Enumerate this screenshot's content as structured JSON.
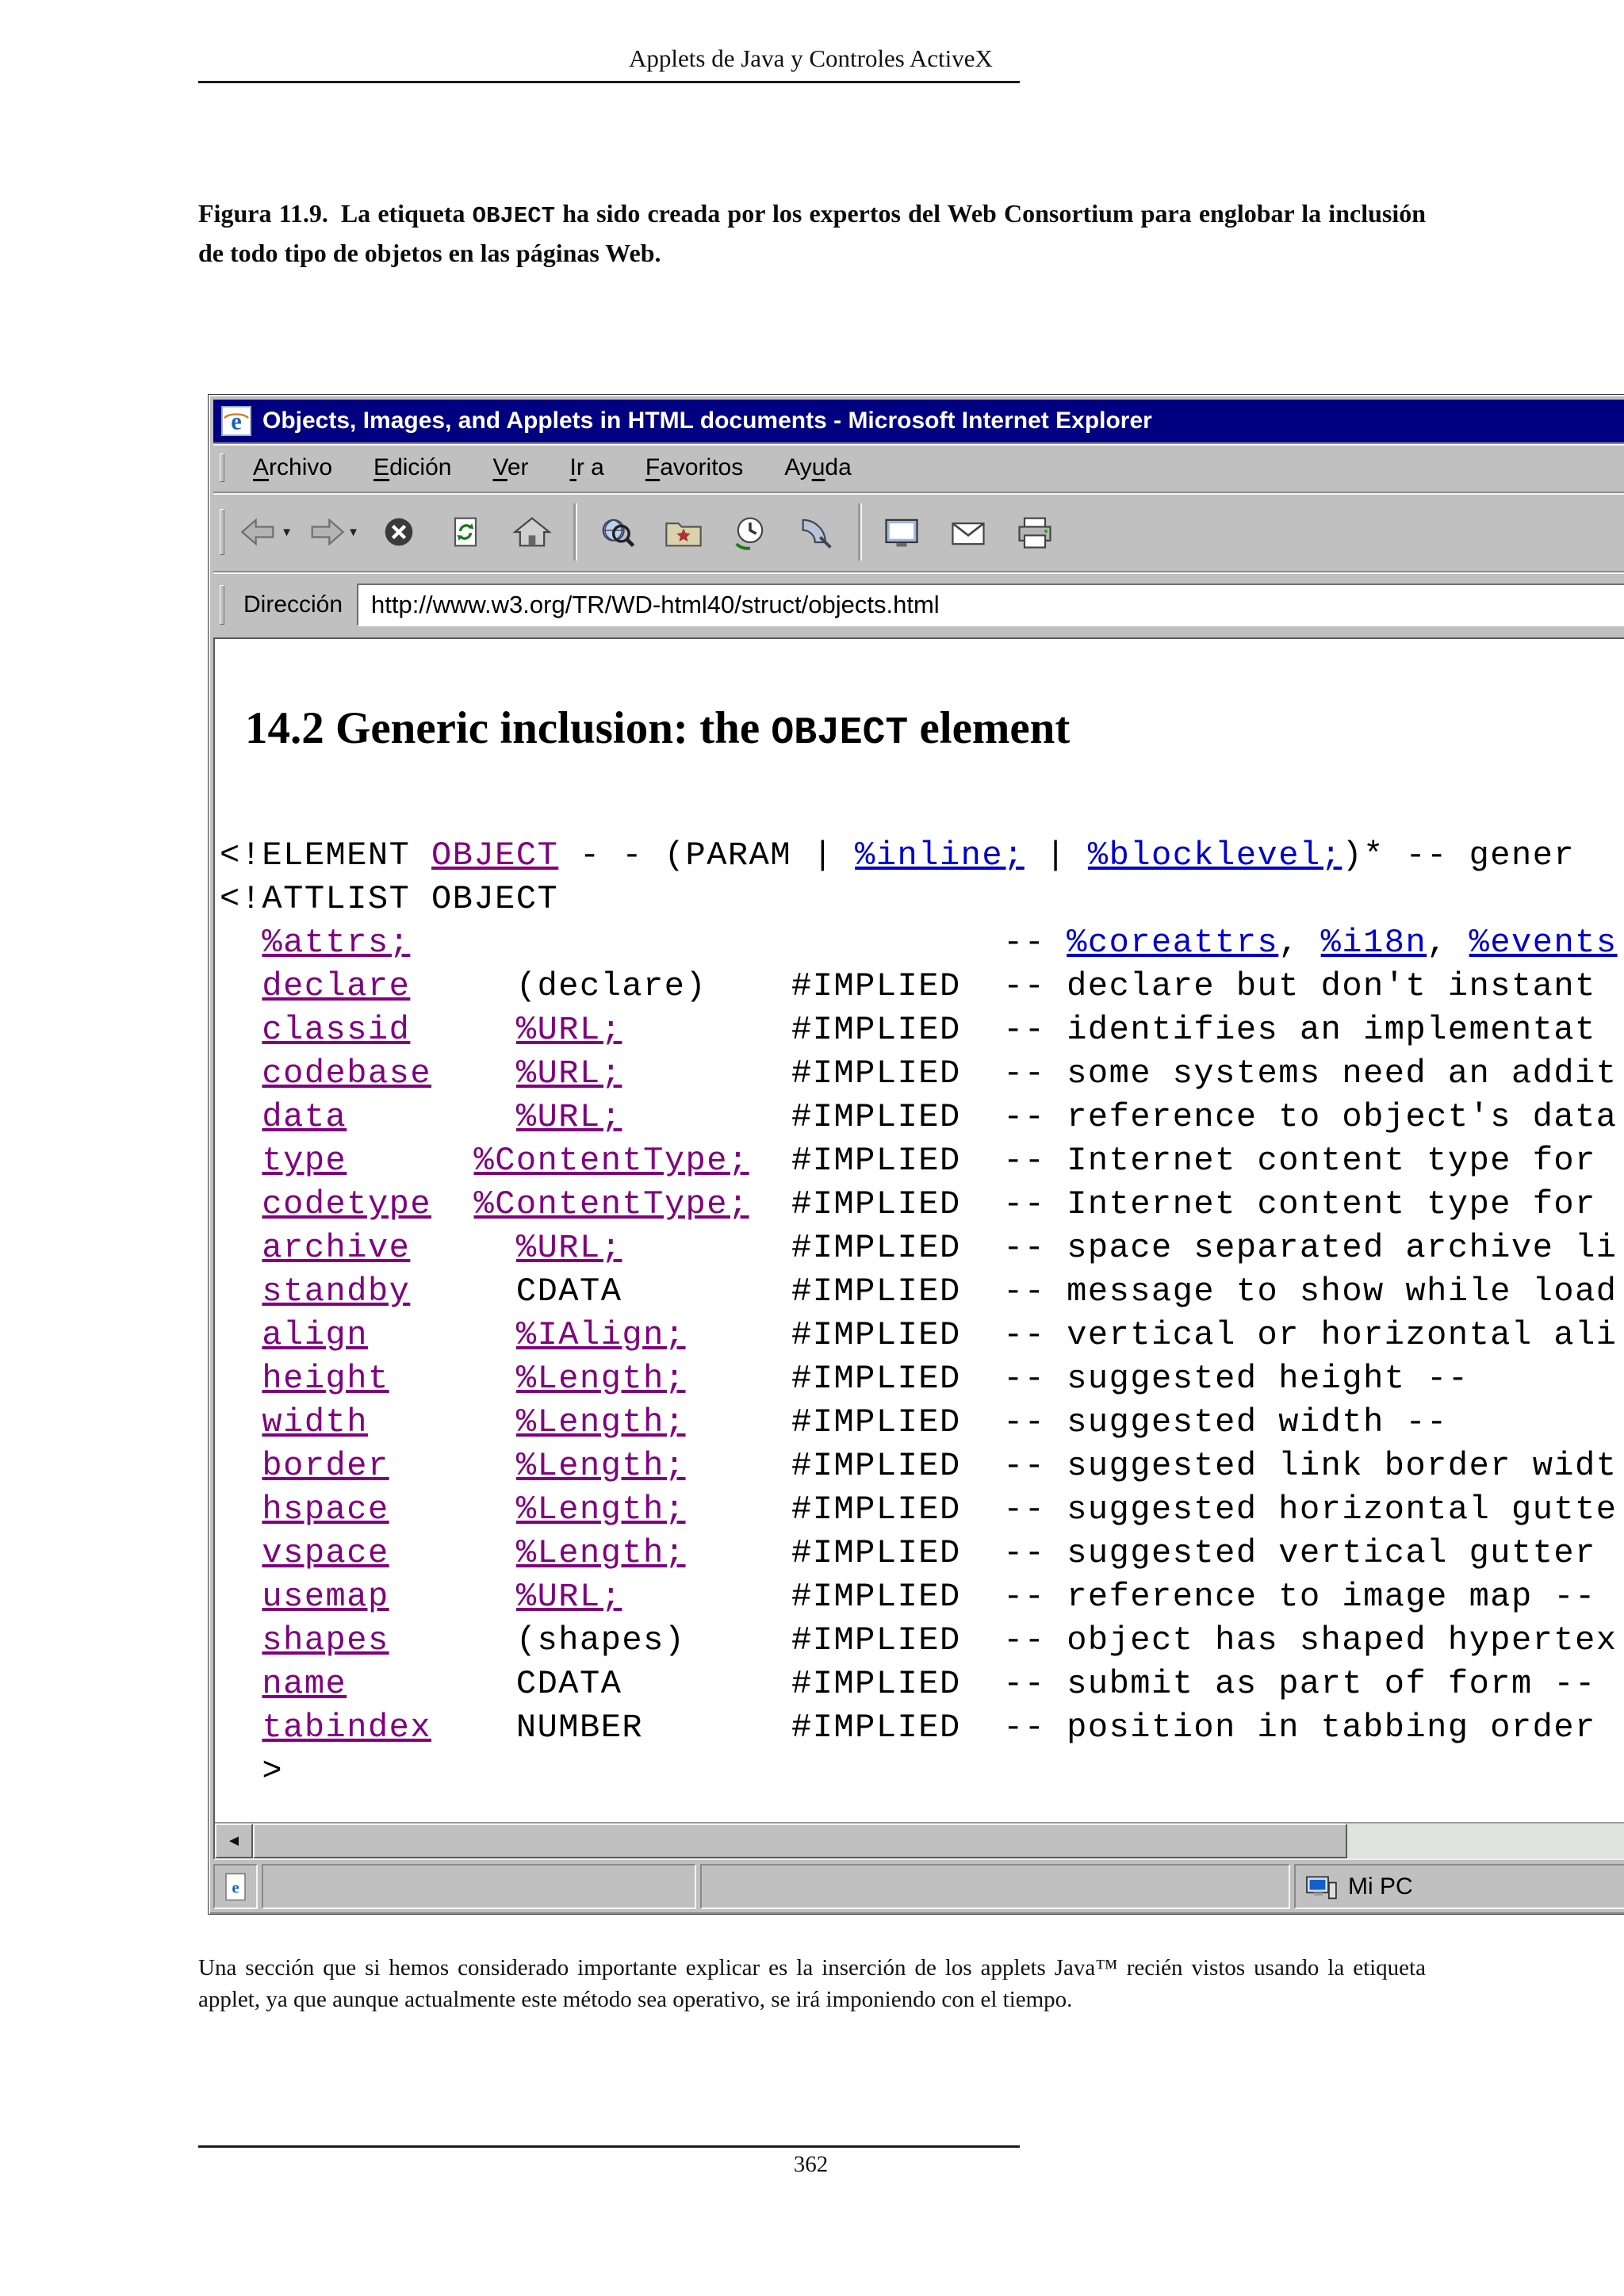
{
  "page": {
    "header_title": "Applets de Java y Controles ActiveX",
    "figure_caption": {
      "label": "Figura 11.9.",
      "text_before_code": "La etiqueta ",
      "code": "OBJECT",
      "text_after_code": " ha sido creada por los expertos del Web Consortium para englobar la inclusión de todo tipo de objetos en las páginas Web."
    },
    "body_paragraph": "Una sección que si hemos considerado importante explicar es la inserción de los applets Java™ recién vistos usando la etiqueta applet, ya que aunque actualmente este método sea operativo, se irá imponiendo con el tiempo.",
    "page_number": "362"
  },
  "ie_window": {
    "title": "Objects, Images, and Applets in HTML documents - Microsoft Internet Explorer",
    "menu": [
      {
        "label": "Archivo",
        "accel": 0
      },
      {
        "label": "Edición",
        "accel": 0
      },
      {
        "label": "Ver",
        "accel": 0
      },
      {
        "label": "Ir a",
        "accel": 0
      },
      {
        "label": "Favoritos",
        "accel": 0
      },
      {
        "label": "Ayuda",
        "accel": 2
      }
    ],
    "toolbar_buttons": [
      "back",
      "forward",
      "stop",
      "refresh",
      "home",
      "search",
      "favorites",
      "history",
      "channels",
      "fullscreen",
      "mail",
      "print"
    ],
    "address": {
      "label": "Dirección",
      "url": "http://www.w3.org/TR/WD-html40/struct/objects.html"
    },
    "status_zone": "Mi PC",
    "colors": {
      "titlebar": "#000080",
      "link": "#0000cc",
      "visited_link": "#800080"
    },
    "content": {
      "heading_pre": "14.2 Generic inclusion: the ",
      "heading_code": "OBJECT",
      "heading_post": " element",
      "dtd_lines": [
        [
          [
            "<!ELEMENT ",
            "p"
          ],
          [
            "OBJECT",
            "v"
          ],
          [
            " - - (PARAM | ",
            "p"
          ],
          [
            "%inline;",
            "l"
          ],
          [
            " | ",
            "p"
          ],
          [
            "%blocklevel;",
            "l"
          ],
          [
            ")* -- gener",
            "p"
          ]
        ],
        [
          [
            "<!ATTLIST OBJECT",
            "p"
          ]
        ],
        [
          [
            "  ",
            "p"
          ],
          [
            "%attrs;",
            "v"
          ],
          [
            "                            ",
            "p"
          ],
          [
            "-- ",
            "p"
          ],
          [
            "%coreattrs",
            "l"
          ],
          [
            ", ",
            "p"
          ],
          [
            "%i18n",
            "l"
          ],
          [
            ", ",
            "p"
          ],
          [
            "%events",
            "l"
          ]
        ],
        [
          [
            "  ",
            "p"
          ],
          [
            "declare",
            "v"
          ],
          [
            "     (declare)    #IMPLIED  -- declare but don't instant",
            "p"
          ]
        ],
        [
          [
            "  ",
            "p"
          ],
          [
            "classid",
            "v"
          ],
          [
            "     ",
            "p"
          ],
          [
            "%URL;",
            "v"
          ],
          [
            "        #IMPLIED  -- identifies an implementat",
            "p"
          ]
        ],
        [
          [
            "  ",
            "p"
          ],
          [
            "codebase",
            "v"
          ],
          [
            "    ",
            "p"
          ],
          [
            "%URL;",
            "v"
          ],
          [
            "        #IMPLIED  -- some systems need an addit",
            "p"
          ]
        ],
        [
          [
            "  ",
            "p"
          ],
          [
            "data",
            "v"
          ],
          [
            "        ",
            "p"
          ],
          [
            "%URL;",
            "v"
          ],
          [
            "        #IMPLIED  -- reference to object's data",
            "p"
          ]
        ],
        [
          [
            "  ",
            "p"
          ],
          [
            "type",
            "v"
          ],
          [
            "      ",
            "p"
          ],
          [
            "%ContentType;",
            "v"
          ],
          [
            "  #IMPLIED  -- Internet content type for",
            "p"
          ]
        ],
        [
          [
            "  ",
            "p"
          ],
          [
            "codetype",
            "v"
          ],
          [
            "  ",
            "p"
          ],
          [
            "%ContentType;",
            "v"
          ],
          [
            "  #IMPLIED  -- Internet content type for",
            "p"
          ]
        ],
        [
          [
            "  ",
            "p"
          ],
          [
            "archive",
            "v"
          ],
          [
            "     ",
            "p"
          ],
          [
            "%URL;",
            "v"
          ],
          [
            "        #IMPLIED  -- space separated archive li",
            "p"
          ]
        ],
        [
          [
            "  ",
            "p"
          ],
          [
            "standby",
            "v"
          ],
          [
            "     CDATA        #IMPLIED  -- message to show while load",
            "p"
          ]
        ],
        [
          [
            "  ",
            "p"
          ],
          [
            "align",
            "v"
          ],
          [
            "       ",
            "p"
          ],
          [
            "%IAlign;",
            "v"
          ],
          [
            "     #IMPLIED  -- vertical or horizontal ali",
            "p"
          ]
        ],
        [
          [
            "  ",
            "p"
          ],
          [
            "height",
            "v"
          ],
          [
            "      ",
            "p"
          ],
          [
            "%Length;",
            "v"
          ],
          [
            "     #IMPLIED  -- suggested height --",
            "p"
          ]
        ],
        [
          [
            "  ",
            "p"
          ],
          [
            "width",
            "v"
          ],
          [
            "       ",
            "p"
          ],
          [
            "%Length;",
            "v"
          ],
          [
            "     #IMPLIED  -- suggested width --",
            "p"
          ]
        ],
        [
          [
            "  ",
            "p"
          ],
          [
            "border",
            "v"
          ],
          [
            "      ",
            "p"
          ],
          [
            "%Length;",
            "v"
          ],
          [
            "     #IMPLIED  -- suggested link border widt",
            "p"
          ]
        ],
        [
          [
            "  ",
            "p"
          ],
          [
            "hspace",
            "v"
          ],
          [
            "      ",
            "p"
          ],
          [
            "%Length;",
            "v"
          ],
          [
            "     #IMPLIED  -- suggested horizontal gutte",
            "p"
          ]
        ],
        [
          [
            "  ",
            "p"
          ],
          [
            "vspace",
            "v"
          ],
          [
            "      ",
            "p"
          ],
          [
            "%Length;",
            "v"
          ],
          [
            "     #IMPLIED  -- suggested vertical gutter",
            "p"
          ]
        ],
        [
          [
            "  ",
            "p"
          ],
          [
            "usemap",
            "v"
          ],
          [
            "      ",
            "p"
          ],
          [
            "%URL;",
            "v"
          ],
          [
            "        #IMPLIED  -- reference to image map --",
            "p"
          ]
        ],
        [
          [
            "  ",
            "p"
          ],
          [
            "shapes",
            "v"
          ],
          [
            "      (shapes)     #IMPLIED  -- object has shaped hypertex",
            "p"
          ]
        ],
        [
          [
            "  ",
            "p"
          ],
          [
            "name",
            "v"
          ],
          [
            "        CDATA        #IMPLIED  -- submit as part of form --",
            "p"
          ]
        ],
        [
          [
            "  ",
            "p"
          ],
          [
            "tabindex",
            "v"
          ],
          [
            "    NUMBER       #IMPLIED  -- position in tabbing order",
            "p"
          ]
        ],
        [
          [
            "  >",
            "p"
          ]
        ]
      ]
    }
  }
}
